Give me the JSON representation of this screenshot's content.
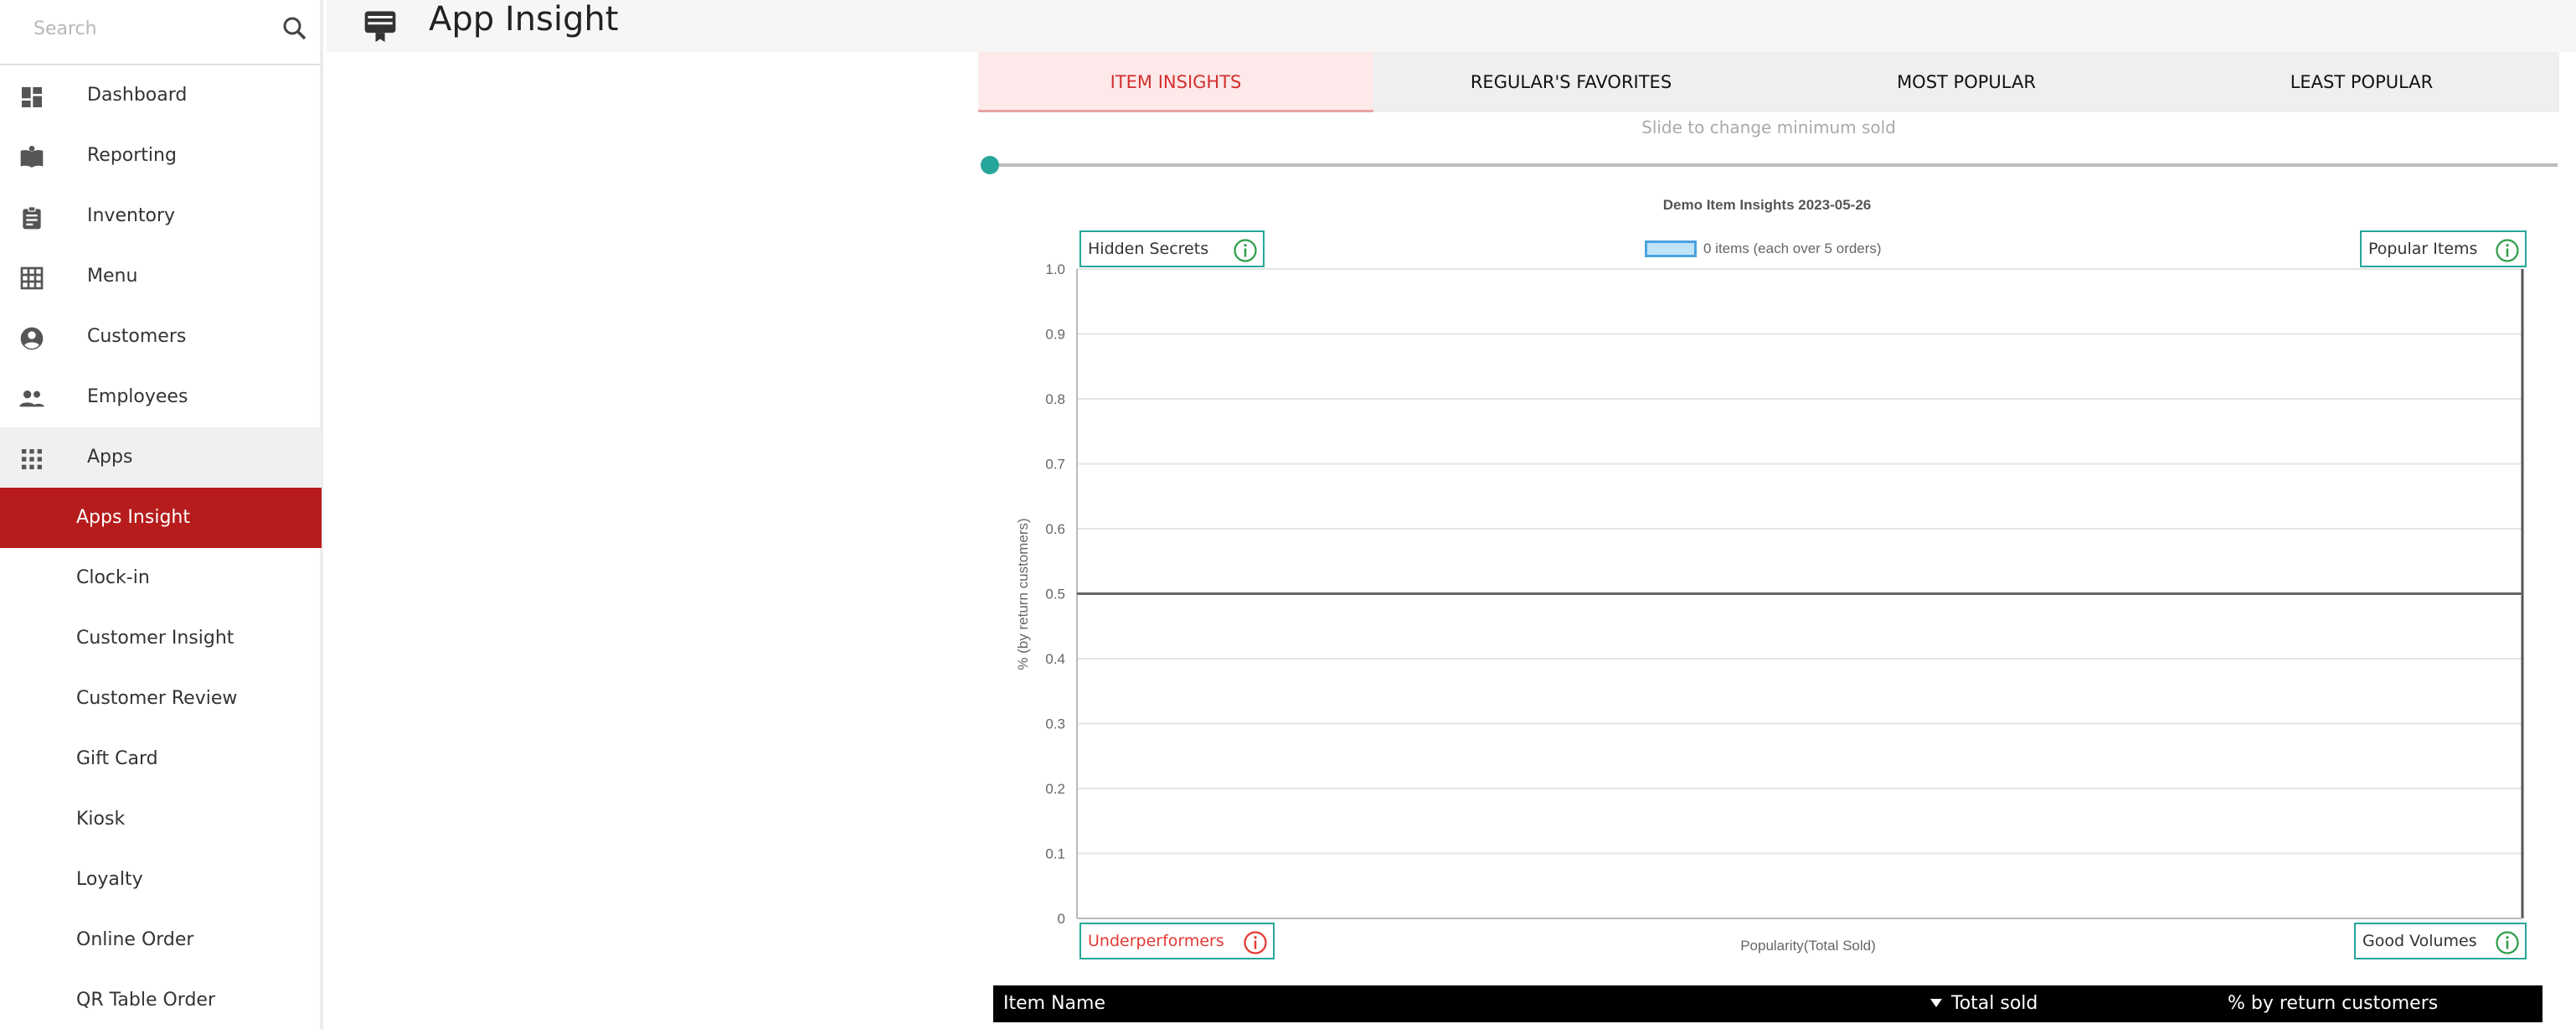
{
  "sidebar": {
    "search_placeholder": "Search",
    "items": [
      {
        "label": "Dashboard",
        "icon": "dashboard-icon"
      },
      {
        "label": "Reporting",
        "icon": "book-icon"
      },
      {
        "label": "Inventory",
        "icon": "clipboard-icon"
      },
      {
        "label": "Menu",
        "icon": "grid-icon"
      },
      {
        "label": "Customers",
        "icon": "account-circle-icon"
      },
      {
        "label": "Employees",
        "icon": "people-icon"
      },
      {
        "label": "Apps",
        "icon": "apps-icon"
      }
    ],
    "sub_items": [
      {
        "label": "Apps Insight",
        "active": true
      },
      {
        "label": "Clock-in"
      },
      {
        "label": "Customer Insight"
      },
      {
        "label": "Customer Review"
      },
      {
        "label": "Gift Card"
      },
      {
        "label": "Kiosk"
      },
      {
        "label": "Loyalty"
      },
      {
        "label": "Online Order"
      },
      {
        "label": "QR Table Order"
      }
    ]
  },
  "header": {
    "title": "App Insight",
    "icon": "app-card-icon"
  },
  "tabs": [
    {
      "label": "ITEM INSIGHTS",
      "active": true
    },
    {
      "label": "REGULAR'S FAVORITES"
    },
    {
      "label": "MOST POPULAR"
    },
    {
      "label": "LEAST POPULAR"
    }
  ],
  "slider": {
    "caption": "Slide to change minimum sold",
    "value": 0
  },
  "quadrants": {
    "top_left": "Hidden Secrets",
    "top_right": "Popular Items",
    "bottom_left": "Underperformers",
    "bottom_right": "Good Volumes"
  },
  "colors": {
    "accent_red": "#b71c1c",
    "teal": "#26a69a",
    "legend_fill": "#bfe3f7",
    "legend_border": "#4aa3df"
  },
  "chart_data": {
    "type": "scatter",
    "title": "Demo Item Insights 2023-05-26",
    "xlabel": "Popularity(Total Sold)",
    "ylabel": "% (by return customers)",
    "ylim": [
      0,
      1.0
    ],
    "yticks": [
      "0",
      "0.1",
      "0.2",
      "0.3",
      "0.4",
      "0.5",
      "0.6",
      "0.7",
      "0.8",
      "0.9",
      "1.0"
    ],
    "midline_y": 0.5,
    "grid": true,
    "legend_position": "top-center",
    "series": [
      {
        "name": "0 items (each over 5 orders)",
        "points": []
      }
    ]
  },
  "table": {
    "columns": [
      "Item Name",
      "Total sold",
      "% by return customers"
    ],
    "sort_column": "Total sold"
  }
}
